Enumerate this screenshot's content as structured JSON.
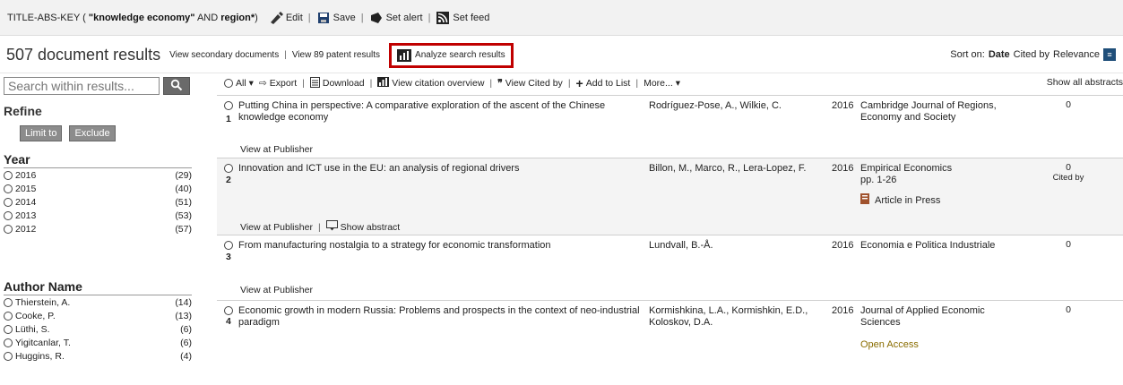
{
  "query": {
    "prefix": "TITLE-ABS-KEY (",
    "term1": "\"knowledge economy\"",
    "op": " AND ",
    "term2": "region*",
    "suffix": ")",
    "actions": [
      {
        "label": "Edit",
        "icon": "edit-icon"
      },
      {
        "label": "Save",
        "icon": "save-icon"
      },
      {
        "label": "Set alert",
        "icon": "alert-icon"
      },
      {
        "label": "Set feed",
        "icon": "rss-icon"
      }
    ]
  },
  "results_bar": {
    "count": "507 document results",
    "secondary": "View secondary documents",
    "patents": "View 89 patent results",
    "analyze": "Analyze search results",
    "sort_label": "Sort on:",
    "sort_options": [
      "Date",
      "Cited by",
      "Relevance"
    ],
    "sort_active": "Date"
  },
  "sidebar": {
    "search_placeholder": "Search within results...",
    "refine": "Refine",
    "limit_to": "Limit to",
    "exclude": "Exclude",
    "year_title": "Year",
    "years": [
      {
        "label": "2016",
        "count": "(29)"
      },
      {
        "label": "2015",
        "count": "(40)"
      },
      {
        "label": "2014",
        "count": "(51)"
      },
      {
        "label": "2013",
        "count": "(53)"
      },
      {
        "label": "2012",
        "count": "(57)"
      }
    ],
    "author_title": "Author Name",
    "authors": [
      {
        "label": "Thierstein, A.",
        "count": "(14)"
      },
      {
        "label": "Cooke, P.",
        "count": "(13)"
      },
      {
        "label": "Lüthi, S.",
        "count": "(6)"
      },
      {
        "label": "Yigitcanlar, T.",
        "count": "(6)"
      },
      {
        "label": "Huggins, R.",
        "count": "(4)"
      }
    ]
  },
  "toolbar": {
    "all": "All",
    "export": "Export",
    "download": "Download",
    "citation_overview": "View citation overview",
    "cited_by": "View Cited by",
    "add_to_list": "Add to List",
    "more": "More...",
    "show_all_abstracts": "Show all abstracts"
  },
  "results": [
    {
      "num": "1",
      "title": "Putting China in perspective: A comparative exploration of the ascent of the Chinese knowledge economy",
      "authors": "Rodríguez-Pose, A., Wilkie, C.",
      "year": "2016",
      "source": "Cambridge Journal of Regions, Economy and Society",
      "cited": "0",
      "view_publisher": "View at Publisher"
    },
    {
      "num": "2",
      "title": "Innovation and ICT use in the EU: an analysis of regional drivers",
      "authors": "Billon, M., Marco, R., Lera-Lopez, F.",
      "year": "2016",
      "source": "Empirical Economics",
      "source_pages": "pp. 1-26",
      "cited": "0",
      "cited_label": "Cited by",
      "badge": "Article in Press",
      "view_publisher": "View at Publisher",
      "show_abstract": "Show abstract"
    },
    {
      "num": "3",
      "title": "From manufacturing nostalgia to a strategy for economic transformation",
      "authors": "Lundvall, B.-Å.",
      "year": "2016",
      "source": "Economia e Politica Industriale",
      "cited": "0",
      "view_publisher": "View at Publisher"
    },
    {
      "num": "4",
      "title": "Economic growth in modern Russia: Problems and prospects in the context of neo-industrial paradigm",
      "authors": "Kormishkina, L.A., Kormishkin, E.D., Koloskov, D.A.",
      "year": "2016",
      "source": "Journal of Applied Economic Sciences",
      "cited": "0",
      "badge": "Open Access"
    }
  ]
}
